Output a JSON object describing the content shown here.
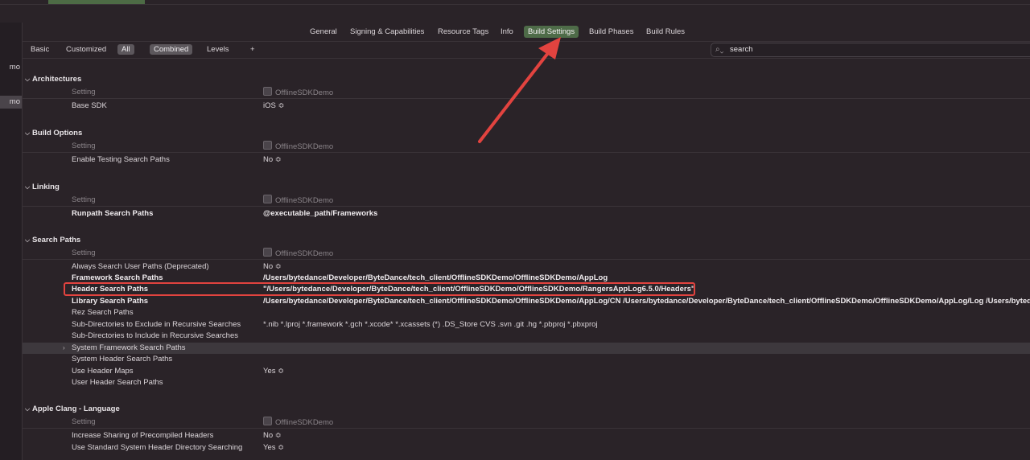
{
  "sidebar": {
    "items": [
      {
        "label": "mo",
        "selected": false
      },
      {
        "label": "mo",
        "selected": true
      }
    ]
  },
  "tabs": [
    {
      "label": "General",
      "active": false
    },
    {
      "label": "Signing & Capabilities",
      "active": false
    },
    {
      "label": "Resource Tags",
      "active": false
    },
    {
      "label": "Info",
      "active": false
    },
    {
      "label": "Build Settings",
      "active": true
    },
    {
      "label": "Build Phases",
      "active": false
    },
    {
      "label": "Build Rules",
      "active": false
    }
  ],
  "filters": {
    "basic": "Basic",
    "customized": "Customized",
    "all": "All",
    "combined": "Combined",
    "levels": "Levels",
    "add": "+"
  },
  "search": {
    "value": "search"
  },
  "icons": {
    "search": "magnifier-icon",
    "chevron": "chevron-down-icon",
    "disclosure": "disclosure-right-icon"
  },
  "colors": {
    "active_tab": "#4e6b48",
    "highlight_box": "#e2433f",
    "arrow": "#e2433f"
  },
  "target_column": "OfflineSDKDemo",
  "sections": [
    {
      "title": "Architectures",
      "rows": [
        {
          "name": "Setting",
          "value": "OfflineSDKDemo",
          "header": true
        },
        {
          "name": "Base SDK",
          "value": "iOS ≎"
        }
      ]
    },
    {
      "title": "Build Options",
      "rows": [
        {
          "name": "Setting",
          "value": "OfflineSDKDemo",
          "header": true
        },
        {
          "name": "Enable Testing Search Paths",
          "value": "No ≎"
        }
      ]
    },
    {
      "title": "Linking",
      "rows": [
        {
          "name": "Setting",
          "value": "OfflineSDKDemo",
          "header": true
        },
        {
          "name": "Runpath Search Paths",
          "value": "@executable_path/Frameworks",
          "bold": true
        }
      ]
    },
    {
      "title": "Search Paths",
      "rows": [
        {
          "name": "Setting",
          "value": "OfflineSDKDemo",
          "header": true
        },
        {
          "name": "Always Search User Paths (Deprecated)",
          "value": "No ≎"
        },
        {
          "name": "Framework Search Paths",
          "value": "/Users/bytedance/Developer/ByteDance/tech_client/OfflineSDKDemo/OfflineSDKDemo/AppLog",
          "bold": true
        },
        {
          "name": "Header Search Paths",
          "value": "\"/Users/bytedance/Developer/ByteDance/tech_client/OfflineSDKDemo/OfflineSDKDemo/RangersAppLog6.5.0/Headers\"",
          "bold": true
        },
        {
          "name": "Library Search Paths",
          "value": "/Users/bytedance/Developer/ByteDance/tech_client/OfflineSDKDemo/OfflineSDKDemo/AppLog/CN /Users/bytedance/Developer/ByteDance/tech_client/OfflineSDKDemo/OfflineSDKDemo/AppLog/Log /Users/bytedan",
          "bold": true
        },
        {
          "name": "Rez Search Paths",
          "value": ""
        },
        {
          "name": "Sub-Directories to Exclude in Recursive Searches",
          "value": "*.nib *.lproj *.framework *.gch *.xcode* *.xcassets (*) .DS_Store CVS .svn .git .hg *.pbproj *.pbxproj"
        },
        {
          "name": "Sub-Directories to Include in Recursive Searches",
          "value": ""
        },
        {
          "name": "System Framework Search Paths",
          "value": "",
          "highlight": true
        },
        {
          "name": "System Header Search Paths",
          "value": ""
        },
        {
          "name": "Use Header Maps",
          "value": "Yes ≎"
        },
        {
          "name": "User Header Search Paths",
          "value": ""
        }
      ]
    },
    {
      "title": "Apple Clang - Language",
      "rows": [
        {
          "name": "Setting",
          "value": "OfflineSDKDemo",
          "header": true
        },
        {
          "name": "Increase Sharing of Precompiled Headers",
          "value": "No ≎"
        },
        {
          "name": "Use Standard System Header Directory Searching",
          "value": "Yes ≎"
        }
      ]
    }
  ]
}
